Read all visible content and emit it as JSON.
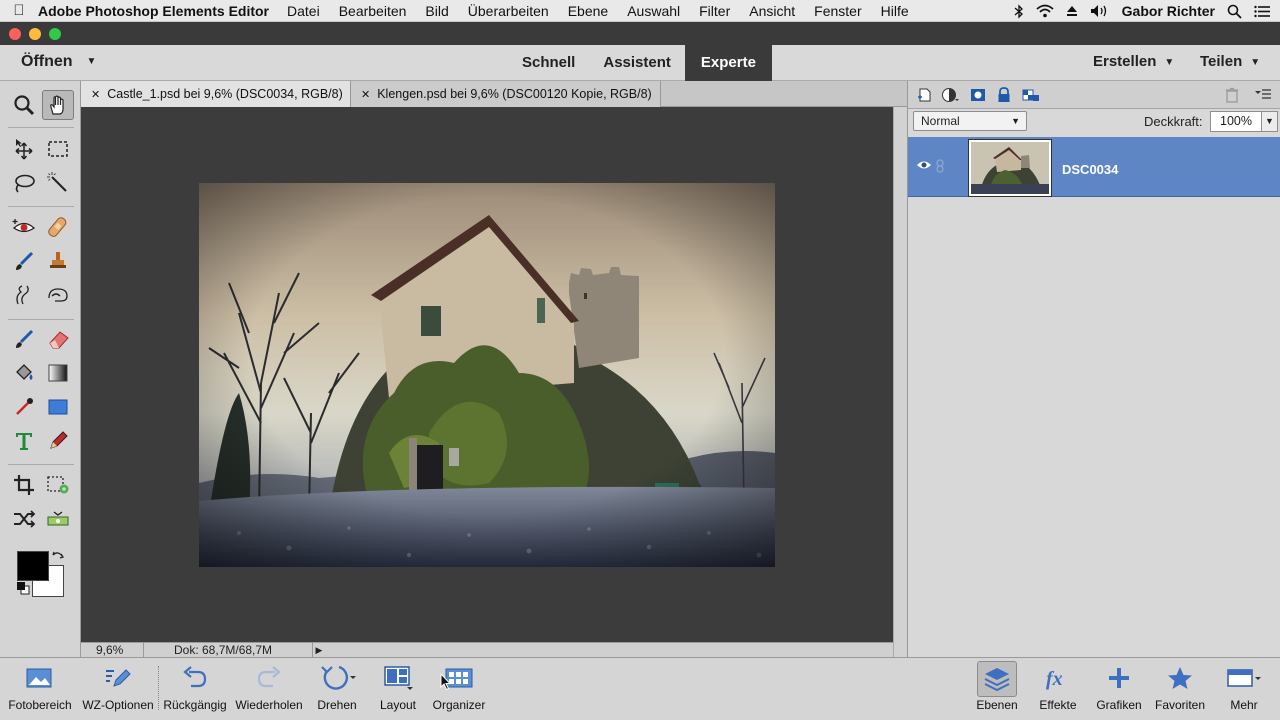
{
  "menubar": {
    "app_name": "Adobe Photoshop Elements Editor",
    "items": [
      "Datei",
      "Bearbeiten",
      "Bild",
      "Überarbeiten",
      "Ebene",
      "Auswahl",
      "Filter",
      "Ansicht",
      "Fenster",
      "Hilfe"
    ],
    "user": "Gabor Richter"
  },
  "topbar": {
    "open_label": "Öffnen",
    "modes": [
      "Schnell",
      "Assistent",
      "Experte"
    ],
    "active_mode": "Experte",
    "create_label": "Erstellen",
    "share_label": "Teilen"
  },
  "tabs": [
    {
      "label": "Castle_1.psd bei 9,6% (DSC0034, RGB/8) *",
      "active": true
    },
    {
      "label": "Klengen.psd bei 9,6% (DSC00120 Kopie, RGB/8) *",
      "active": false
    }
  ],
  "status": {
    "zoom": "9,6%",
    "doc_size": "Dok: 68,7M/68,7M"
  },
  "layers_panel": {
    "blend_mode": "Normal",
    "opacity_label": "Deckkraft:",
    "opacity_value": "100%",
    "layer_name": "DSC0034"
  },
  "bottom_bar": {
    "photo_bin": "Fotobereich",
    "tool_options": "WZ-Optionen",
    "undo": "Rückgängig",
    "redo": "Wiederholen",
    "rotate": "Drehen",
    "layout": "Layout",
    "organizer": "Organizer",
    "layers": "Ebenen",
    "effects": "Effekte",
    "graphics": "Grafiken",
    "favorites": "Favoriten",
    "more": "Mehr"
  },
  "colors": {
    "accent": "#5e86c5",
    "mode_active_bg": "#3a3a3a",
    "canvas_bg": "#3c3c3c",
    "foreground_swatch": "#000000",
    "background_swatch": "#ffffff"
  }
}
